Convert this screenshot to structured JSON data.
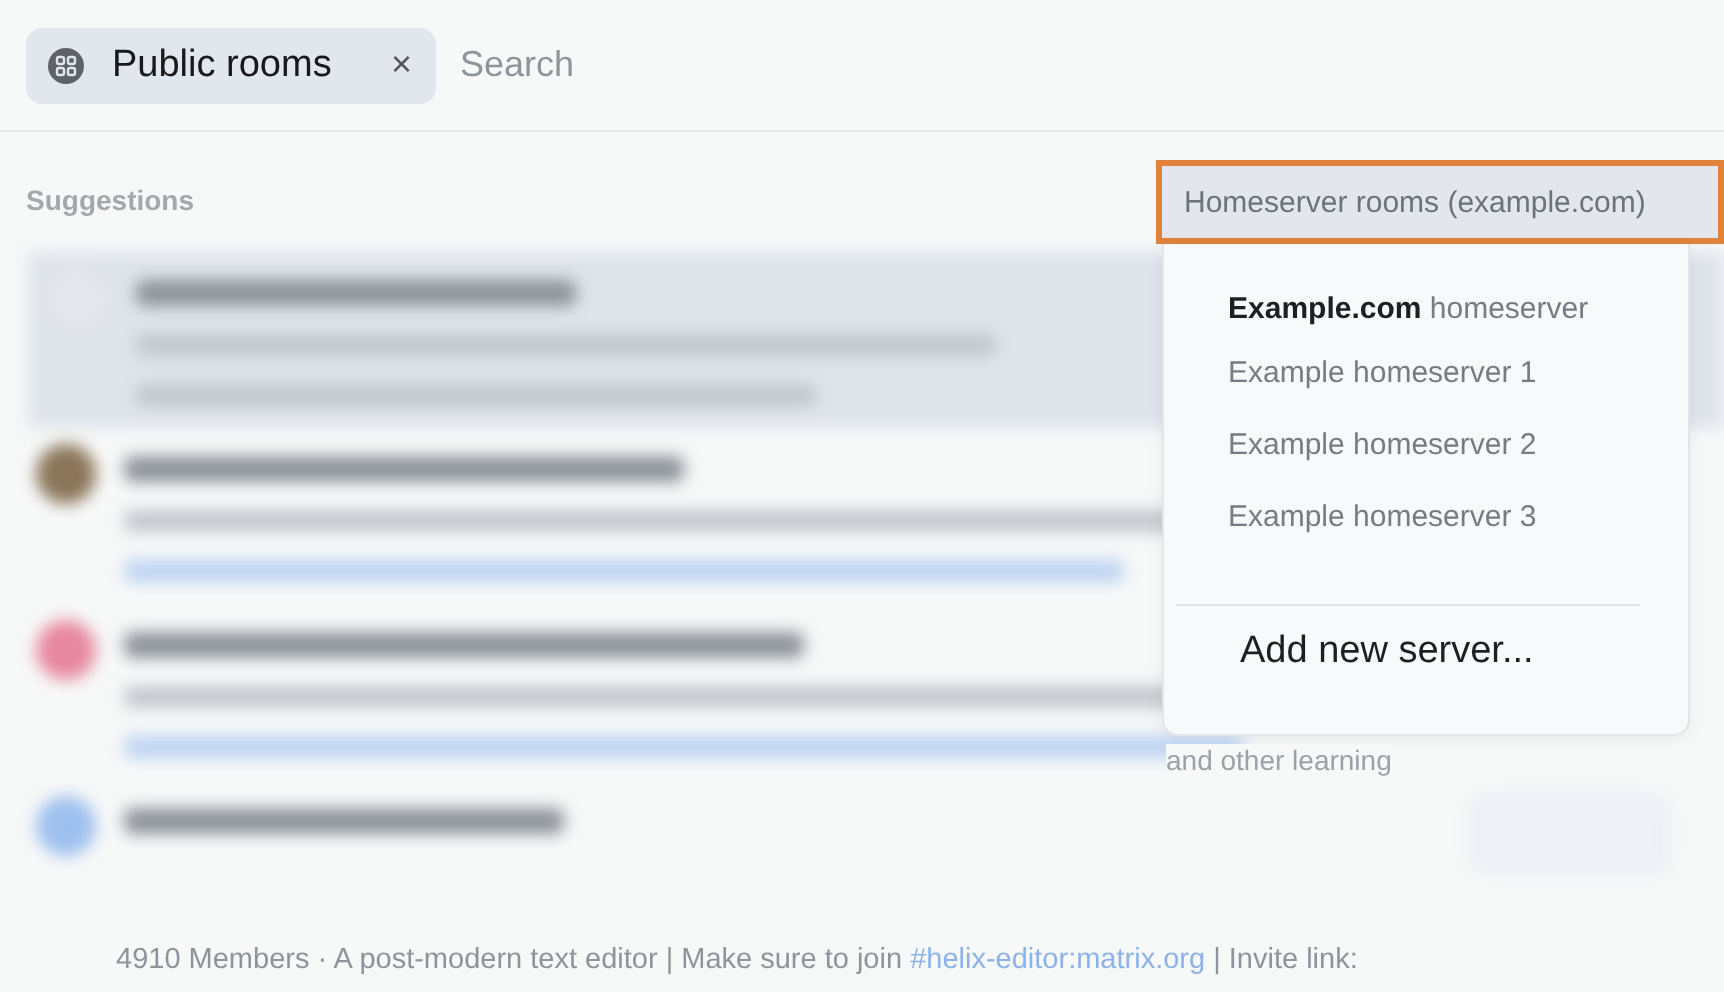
{
  "search": {
    "chip": {
      "label": "Public rooms"
    },
    "clear": "×",
    "placeholder": "Search"
  },
  "results": {
    "heading": "Suggestions",
    "partial_text": "and other learning",
    "last_row_description": "4910 Members · A post-modern text editor | Make sure to join **#helix-editor:matrix.org** | Invite link:"
  },
  "server_dropdown": {
    "button": "Homeserver rooms (example.com)",
    "servers": [
      {
        "label": "**Example.com** homeserver"
      },
      {
        "label": "Example homeserver 1"
      },
      {
        "label": "Example homeserver 2"
      },
      {
        "label": "Example homeserver 3"
      }
    ],
    "add_server": "Add new server..."
  }
}
